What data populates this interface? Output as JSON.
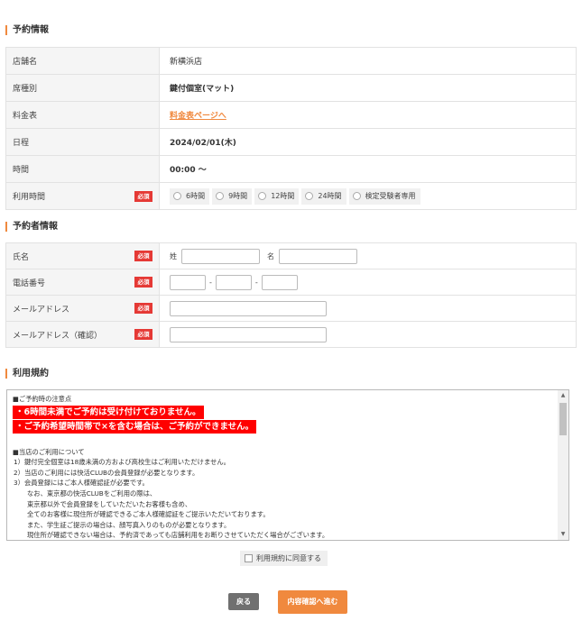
{
  "reservation": {
    "title": "予約情報",
    "store_label": "店舗名",
    "store_value": "新横浜店",
    "seat_label": "席種別",
    "seat_value": "鍵付個室(マット)",
    "fee_label": "料金表",
    "fee_link": "料金表ページへ",
    "date_label": "日程",
    "date_value": "2024/02/01(木)",
    "time_label": "時間",
    "time_value": "00:00 ～",
    "duration_label": "利用時間",
    "required": "必須",
    "duration_options": [
      "6時間",
      "9時間",
      "12時間",
      "24時間",
      "検定受験者専用"
    ]
  },
  "applicant": {
    "title": "予約者情報",
    "name_label": "氏名",
    "last_name_label": "姓",
    "first_name_label": "名",
    "phone_label": "電話番号",
    "phone_sep": "-",
    "email_label": "メールアドレス",
    "email_confirm_label": "メールアドレス（確認）",
    "required": "必須"
  },
  "terms": {
    "title": "利用規約",
    "lines": [
      "■ご予約時の注意点",
      "・6時間未満でご予約は受け付けておりません。",
      "・ご予約希望時間帯で×を含む場合は、ご予約ができません。",
      "■当店のご利用について",
      "1）鍵付完全個室は18歳未満の方および高校生はご利用いただけません。",
      "2）当店のご利用には快活CLUBの会員登録が必要となります。",
      "3）会員登録にはご本人様確認証が必要です。",
      "なお、東京都の快活CLUBをご利用の際は、",
      "東京都以外で会員登録をしていただいたお客様も含め、",
      "全てのお客様に現住所が確認できるご本人様確認証をご提示いただいております。",
      "また、学生証ご提示の場合は、顔写真入りのものが必要となります。",
      "現住所が確認できない場合は、予約済であっても店舗利用をお断りさせていただく場合がございます。"
    ],
    "agree_label": "利用規約に同意する"
  },
  "buttons": {
    "back": "戻る",
    "next": "内容確認へ進む"
  },
  "colors": {
    "accent": "#f0893e",
    "required": "#e53935",
    "highlight": "#ff0000",
    "back_button": "#707070"
  }
}
